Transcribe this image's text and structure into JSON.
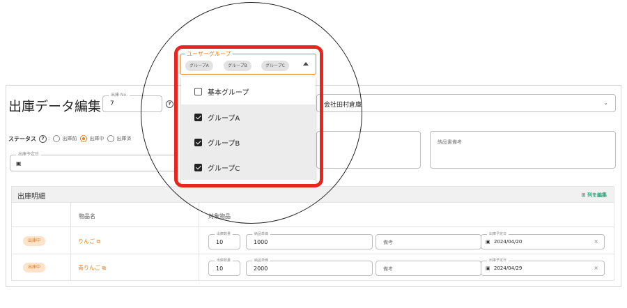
{
  "page": {
    "title": "出庫データ編集",
    "shipment_no": {
      "label": "出庫 No.",
      "value": "7"
    },
    "warehouse": {
      "value": "会社田村倉庫"
    },
    "status": {
      "label": "ステータス",
      "options": [
        "出庫前",
        "出庫中",
        "出庫済"
      ],
      "selected": "出庫中"
    },
    "scheduled_date": {
      "label": "出庫予定日",
      "value": ""
    },
    "note_field": {
      "placeholder": "納品書備考"
    }
  },
  "table": {
    "title": "出庫明細",
    "edit_columns_label": "列を編集",
    "columns": [
      "",
      "物品名",
      "対象物品"
    ],
    "field_labels": {
      "qty": "出庫数量",
      "price": "納品単価",
      "note": "備考",
      "date": "出庫予定日"
    },
    "rows": [
      {
        "status": "出庫中",
        "item": "りんご",
        "qty": "10",
        "price": "1000",
        "note": "備考",
        "date": "2024/04/20"
      },
      {
        "status": "出庫中",
        "item": "青りんご",
        "qty": "10",
        "price": "2000",
        "note": "備考",
        "date": "2024/04/29"
      }
    ]
  },
  "user_group": {
    "label": "ユーザーグループ",
    "chips": [
      "グループA",
      "グループB",
      "グループC"
    ],
    "options": [
      {
        "label": "基本グループ",
        "checked": false
      },
      {
        "label": "グループA",
        "checked": true
      },
      {
        "label": "グループB",
        "checked": true
      },
      {
        "label": "グループC",
        "checked": true
      }
    ]
  },
  "colors": {
    "accent": "#e67e22",
    "highlight": "#e8261e",
    "link_green": "#27a37b"
  }
}
